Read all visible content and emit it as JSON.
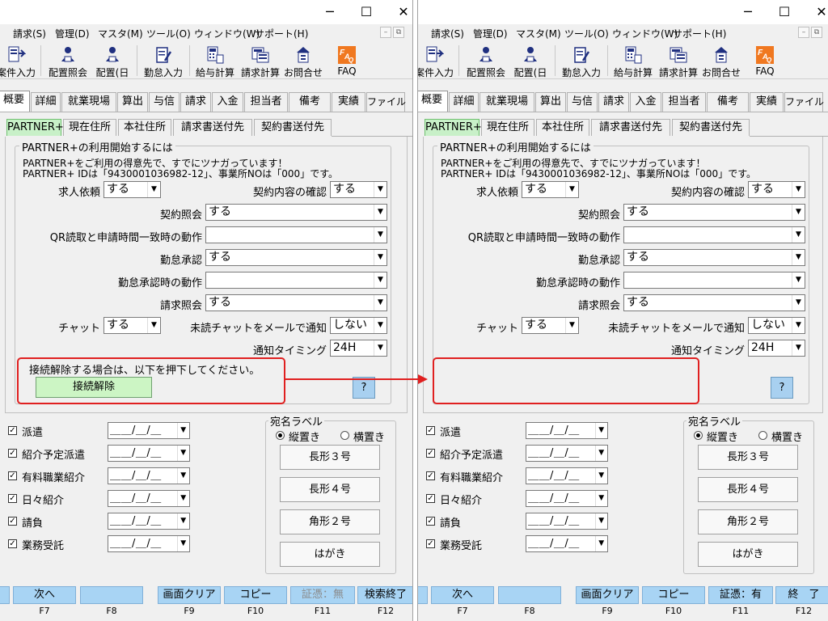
{
  "window_controls": {
    "minimize": "─",
    "maximize": "☐",
    "close": "✕"
  },
  "menus": [
    "請求(S)",
    "管理(D)",
    "マスタ(M)",
    "ツール(O)",
    "ウィンドウ(W)",
    "サポート(H)"
  ],
  "mdi_buttons": [
    "–",
    "⧉"
  ],
  "toolbar": [
    {
      "label": "案件入力",
      "icon": "case-entry-icon"
    },
    {
      "label": "配置照会",
      "icon": "assignment-inquiry-icon"
    },
    {
      "label": "配置(日",
      "icon": "daily-assignment-icon"
    },
    {
      "label": "勤怠入力",
      "icon": "attendance-entry-icon"
    },
    {
      "label": "給与計算",
      "icon": "payroll-icon"
    },
    {
      "label": "請求計算",
      "icon": "billing-calc-icon"
    },
    {
      "label": "お問合せ",
      "icon": "inquiry-icon"
    },
    {
      "label": "FAQ",
      "icon": "faq-icon"
    }
  ],
  "tabs": [
    "概要",
    "詳細",
    "就業現場",
    "算出",
    "与信",
    "請求",
    "入金",
    "担当者",
    "備考",
    "実績",
    "ファイル"
  ],
  "subtabs": [
    "PARTNER+",
    "現在住所",
    "本社住所",
    "請求書送付先",
    "契約書送付先"
  ],
  "partner": {
    "group_title": "PARTNER+の利用開始するには",
    "info_line1": "PARTNER+をご利用の得意先で、すでにツナガっています！",
    "info_line2": "PARTNER+ IDは「9430001036982-12」、事業所NOは「000」です。",
    "fields": {
      "job_request": {
        "label": "求人依頼",
        "value": "する"
      },
      "contract_check": {
        "label": "契約内容の確認",
        "value": "する"
      },
      "contract_inquiry": {
        "label": "契約照会",
        "value": "する"
      },
      "qr_action": {
        "label": "QR読取と申請時間一致時の動作",
        "value": ""
      },
      "attendance_approval": {
        "label": "勤怠承認",
        "value": "する"
      },
      "approval_action": {
        "label": "勤怠承認時の動作",
        "value": ""
      },
      "billing_inquiry": {
        "label": "請求照会",
        "value": "する"
      },
      "chat": {
        "label": "チャット",
        "value": "する"
      },
      "unread_mail": {
        "label": "未読チャットをメールで通知",
        "value": "しない"
      },
      "notify_timing": {
        "label": "通知タイミング",
        "value": "24H"
      }
    },
    "disconnect_text": "接続解除する場合は、以下を押下してください。",
    "disconnect_button": "接続解除",
    "help_button": "?"
  },
  "checks": [
    {
      "label": "派遣",
      "checked": true
    },
    {
      "label": "紹介予定派遣",
      "checked": true
    },
    {
      "label": "有料職業紹介",
      "checked": true
    },
    {
      "label": "日々紹介",
      "checked": true
    },
    {
      "label": "請負",
      "checked": true
    },
    {
      "label": "業務受託",
      "checked": true
    }
  ],
  "date_placeholder": "＿＿/＿/＿",
  "address_label": {
    "title": "宛名ラベル",
    "orientation_vertical": "縦置き",
    "orientation_horizontal": "横置き",
    "selected": "縦置き",
    "buttons": [
      "長形３号",
      "長形４号",
      "角形２号",
      "はがき"
    ]
  },
  "fkeys_left": [
    {
      "label": "",
      "key": "",
      "disabled": false
    },
    {
      "label": "次へ",
      "key": "F7",
      "disabled": false
    },
    {
      "label": "",
      "key": "F8",
      "disabled": false
    },
    {
      "label": "画面クリア",
      "key": "F9",
      "disabled": false
    },
    {
      "label": "コピー",
      "key": "F10",
      "disabled": false
    },
    {
      "label": "証憑：無",
      "key": "F11",
      "disabled": true
    },
    {
      "label": "検索終了",
      "key": "F12",
      "disabled": false
    }
  ],
  "fkeys_right": [
    {
      "label": "",
      "key": "",
      "disabled": false
    },
    {
      "label": "次へ",
      "key": "F7",
      "disabled": false
    },
    {
      "label": "",
      "key": "F8",
      "disabled": false
    },
    {
      "label": "画面クリア",
      "key": "F9",
      "disabled": false
    },
    {
      "label": "コピー",
      "key": "F10",
      "disabled": false
    },
    {
      "label": "証憑：有",
      "key": "F11",
      "disabled": false
    },
    {
      "label": "終　了",
      "key": "F12",
      "disabled": false
    }
  ],
  "colors": {
    "highlight": "#e02020",
    "fkey": "#a8d4f4",
    "partner_tab": "#c8f0c8",
    "disconnect_button": "#ccf5c4",
    "help_button": "#a8d0f0"
  }
}
